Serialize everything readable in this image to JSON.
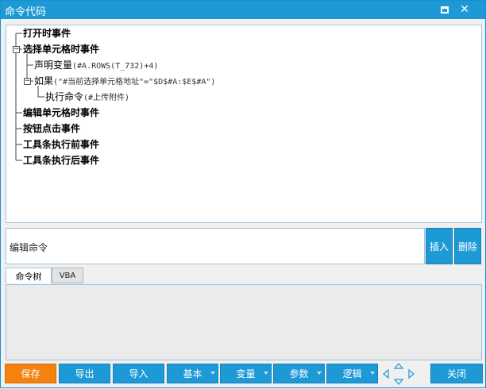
{
  "window": {
    "title": "命令代码",
    "maximize_icon": "maximize-icon",
    "close_icon": "close-icon",
    "close_glyph": "✕"
  },
  "tree": {
    "nodes": [
      {
        "label": "打开时事件",
        "args": "",
        "bold": true,
        "level": 0,
        "expander": ""
      },
      {
        "label": "选择单元格时事件",
        "args": "",
        "bold": true,
        "level": 0,
        "expander": "−"
      },
      {
        "label": "声明变量",
        "args": "(#A.ROWS(T_732)+4)",
        "bold": false,
        "level": 1,
        "expander": ""
      },
      {
        "label": "如果",
        "args": "(\"#当前选择单元格地址\"=\"$D$#A:$E$#A\")",
        "bold": false,
        "level": 1,
        "expander": "−"
      },
      {
        "label": "执行命令",
        "args": "(#上传附件)",
        "bold": false,
        "level": 2,
        "expander": ""
      },
      {
        "label": "编辑单元格时事件",
        "args": "",
        "bold": true,
        "level": 0,
        "expander": ""
      },
      {
        "label": "按钮点击事件",
        "args": "",
        "bold": true,
        "level": 0,
        "expander": ""
      },
      {
        "label": "工具条执行前事件",
        "args": "",
        "bold": true,
        "level": 0,
        "expander": ""
      },
      {
        "label": "工具条执行后事件",
        "args": "",
        "bold": true,
        "level": 0,
        "expander": ""
      }
    ]
  },
  "editor": {
    "value": "编辑命令",
    "insert_label": "插入",
    "delete_label": "删除"
  },
  "tabs": {
    "active": "命令树",
    "inactive": "VBA"
  },
  "toolbar": {
    "save": "保存",
    "export": "导出",
    "import": "导入",
    "basic": "基本",
    "variable": "变量",
    "params": "参数",
    "logic": "逻辑",
    "close": "关闭",
    "nav_icon": "navigation-arrows-icon",
    "accent": "#1d9ad6",
    "save_color": "#f5820f"
  }
}
